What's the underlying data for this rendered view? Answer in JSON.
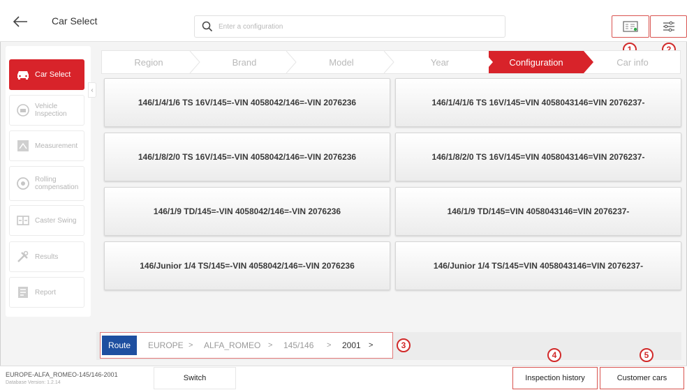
{
  "header": {
    "title": "Car Select",
    "search_placeholder": "Enter a configuration"
  },
  "callouts": [
    "1",
    "2",
    "3",
    "4",
    "5"
  ],
  "sidebar": {
    "items": [
      {
        "label": "Car Select",
        "active": true,
        "icon": "car-icon"
      },
      {
        "label": "Vehicle Inspection",
        "active": false,
        "icon": "inspection-icon"
      },
      {
        "label": "Measurement",
        "active": false,
        "icon": "measurement-icon"
      },
      {
        "label": "Rolling compensation",
        "active": false,
        "icon": "rolling-icon"
      },
      {
        "label": "Caster Swing",
        "active": false,
        "icon": "caster-icon"
      },
      {
        "label": "Results",
        "active": false,
        "icon": "wrench-icon"
      },
      {
        "label": "Report",
        "active": false,
        "icon": "report-icon"
      }
    ]
  },
  "stepper": {
    "steps": [
      "Region",
      "Brand",
      "Model",
      "Year",
      "Configuration",
      "Car info"
    ],
    "active_index": 4
  },
  "configurations": [
    "146/1/4/1/6 TS 16V/145=-VIN 4058042/146=-VIN 2076236",
    "146/1/4/1/6 TS 16V/145=VIN 4058043146=VIN 2076237-",
    "146/1/8/2/0 TS 16V/145=-VIN 4058042/146=-VIN 2076236",
    "146/1/8/2/0 TS 16V/145=VIN 4058043146=VIN 2076237-",
    "146/1/9 TD/145=-VIN 4058042/146=-VIN 2076236",
    "146/1/9 TD/145=VIN 4058043146=VIN 2076237-",
    "146/Junior 1/4 TS/145=-VIN 4058042/146=-VIN 2076236",
    "146/Junior 1/4 TS/145=VIN 4058043146=VIN 2076237-"
  ],
  "route": {
    "label": "Route",
    "crumbs": [
      "EUROPE",
      "ALFA_ROMEO",
      "145/146",
      "2001"
    ],
    "separator": ">"
  },
  "footer": {
    "vehicle_path": "EUROPE-ALFA_ROMEO-145/146-2001",
    "db_version": "Database Version: 1.2.14",
    "switch_label": "Switch",
    "history_label": "Inspection history",
    "customer_label": "Customer cars"
  },
  "colors": {
    "accent": "#d8232a",
    "route_blue": "#1e4fa0",
    "callout_red": "#d12a2a"
  }
}
